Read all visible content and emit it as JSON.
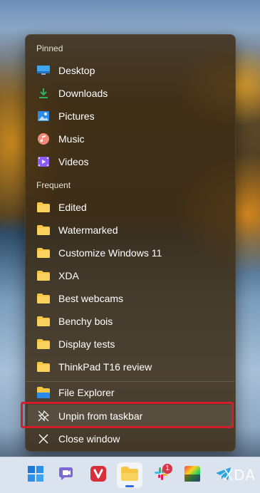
{
  "jump_list": {
    "pinned_title": "Pinned",
    "pinned": [
      {
        "label": "Desktop",
        "icon": "desktop-icon"
      },
      {
        "label": "Downloads",
        "icon": "downloads-icon"
      },
      {
        "label": "Pictures",
        "icon": "pictures-icon"
      },
      {
        "label": "Music",
        "icon": "music-icon"
      },
      {
        "label": "Videos",
        "icon": "videos-icon"
      }
    ],
    "frequent_title": "Frequent",
    "frequent": [
      {
        "label": "Edited",
        "icon": "folder-icon"
      },
      {
        "label": "Watermarked",
        "icon": "folder-icon"
      },
      {
        "label": "Customize Windows 11",
        "icon": "folder-icon"
      },
      {
        "label": "XDA",
        "icon": "folder-icon"
      },
      {
        "label": "Best webcams",
        "icon": "folder-icon"
      },
      {
        "label": "Benchy bois",
        "icon": "folder-icon"
      },
      {
        "label": "Display tests",
        "icon": "folder-icon"
      },
      {
        "label": "ThinkPad T16 review",
        "icon": "folder-icon"
      }
    ],
    "tasks": [
      {
        "label": "File Explorer",
        "icon": "file-explorer-icon"
      },
      {
        "label": "Unpin from taskbar",
        "icon": "unpin-icon"
      },
      {
        "label": "Close window",
        "icon": "close-icon"
      }
    ]
  },
  "taskbar": {
    "apps": [
      {
        "name": "start",
        "icon": "windows-start-icon"
      },
      {
        "name": "teams",
        "icon": "teams-chat-icon"
      },
      {
        "name": "vivaldi",
        "icon": "vivaldi-icon"
      },
      {
        "name": "file-explorer",
        "icon": "file-explorer-icon",
        "active": true
      },
      {
        "name": "slack",
        "icon": "slack-icon",
        "badge": "1"
      },
      {
        "name": "color-app",
        "icon": "color-palette-icon"
      },
      {
        "name": "telegram",
        "icon": "telegram-icon"
      }
    ],
    "slack_badge": "1"
  },
  "watermark": "XDA",
  "colors": {
    "accent": "#2b6cd8",
    "highlight_border": "#d21f2b",
    "folder": "#f6c544"
  }
}
